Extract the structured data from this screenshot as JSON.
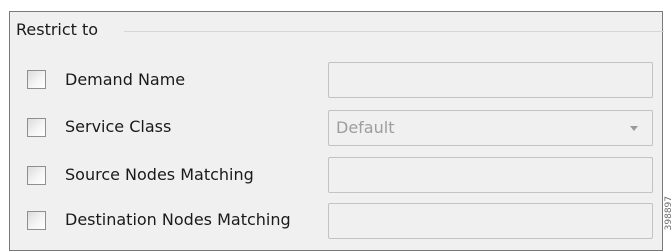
{
  "group": {
    "title": "Restrict to"
  },
  "rows": [
    {
      "label": "Demand Name",
      "checked": false,
      "control": "text",
      "value": ""
    },
    {
      "label": "Service Class",
      "checked": false,
      "control": "select",
      "value": "Default"
    },
    {
      "label": "Source Nodes Matching",
      "checked": false,
      "control": "text",
      "value": ""
    },
    {
      "label": "Destination Nodes Matching",
      "checked": false,
      "control": "text",
      "value": ""
    }
  ],
  "figure_id": "398897",
  "colors": {
    "panel_bg": "#f0f0f0",
    "border": "#7a7a7a",
    "disabled_text": "#9d9d9d"
  },
  "icons": {
    "select_caret": "chevron-down-icon"
  }
}
